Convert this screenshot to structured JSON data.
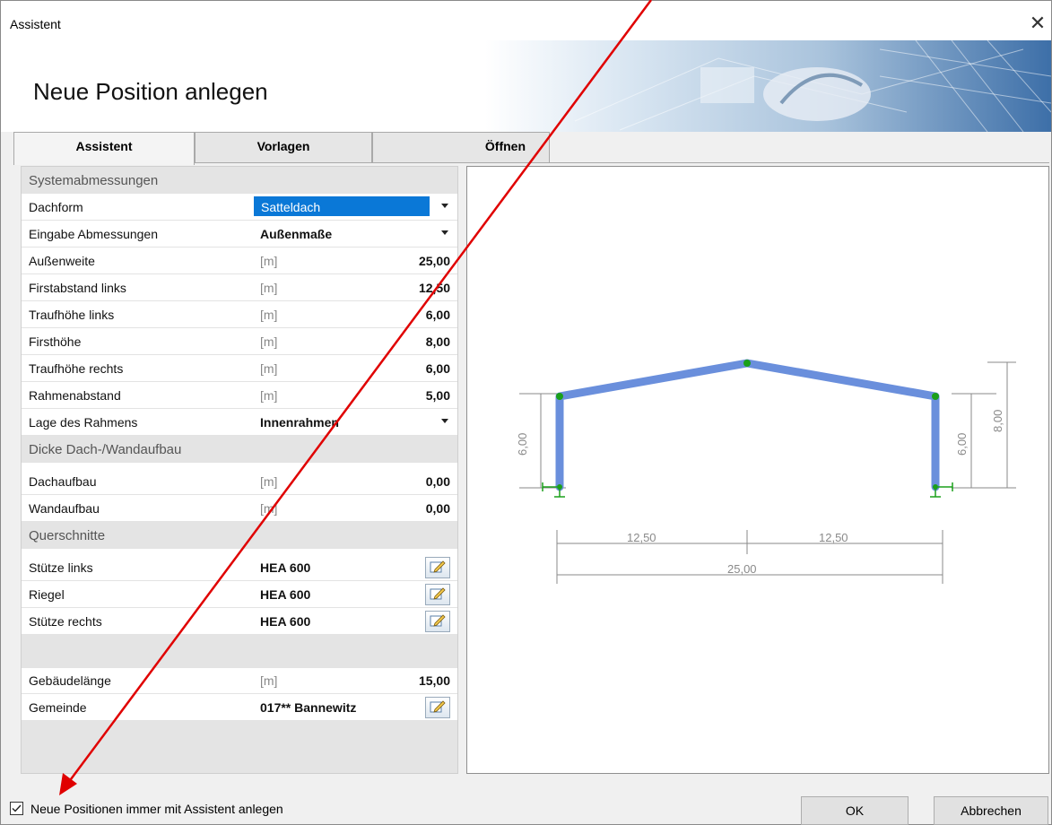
{
  "window": {
    "title": "Assistent",
    "close_icon": "close-icon"
  },
  "banner": {
    "heading": "Neue Position anlegen"
  },
  "tabs": [
    {
      "label": "Assistent",
      "active": true
    },
    {
      "label": "Vorlagen",
      "active": false
    },
    {
      "label": "Öffnen",
      "active": false
    }
  ],
  "grid": {
    "sections": {
      "system": "Systemabmessungen",
      "thickness": "Dicke Dach-/Wandaufbau",
      "cross": "Querschnitte"
    },
    "rows": {
      "dachform": {
        "label": "Dachform",
        "value": "Satteldach"
      },
      "eingabe": {
        "label": "Eingabe Abmessungen",
        "value": "Außenmaße"
      },
      "aussenweite": {
        "label": "Außenweite",
        "unit": "[m]",
        "value": "25,00"
      },
      "firstabstand": {
        "label": "Firstabstand links",
        "unit": "[m]",
        "value": "12,50"
      },
      "traufhoehe_l": {
        "label": "Traufhöhe links",
        "unit": "[m]",
        "value": "6,00"
      },
      "firsthoehe": {
        "label": "Firsthöhe",
        "unit": "[m]",
        "value": "8,00"
      },
      "traufhoehe_r": {
        "label": "Traufhöhe rechts",
        "unit": "[m]",
        "value": "6,00"
      },
      "rahmenabstand": {
        "label": "Rahmenabstand",
        "unit": "[m]",
        "value": "5,00"
      },
      "lage": {
        "label": "Lage des Rahmens",
        "value": "Innenrahmen"
      },
      "dachaufbau": {
        "label": "Dachaufbau",
        "unit": "[m]",
        "value": "0,00"
      },
      "wandaufbau": {
        "label": "Wandaufbau",
        "unit": "[m]",
        "value": "0,00"
      },
      "stuetze_l": {
        "label": "Stütze links",
        "value": "HEA 600"
      },
      "riegel": {
        "label": "Riegel",
        "value": "HEA 600"
      },
      "stuetze_r": {
        "label": "Stütze rechts",
        "value": "HEA 600"
      },
      "gebaeudelaenge": {
        "label": "Gebäudelänge",
        "unit": "[m]",
        "value": "15,00"
      },
      "gemeinde": {
        "label": "Gemeinde",
        "value": "017** Bannewitz"
      }
    }
  },
  "preview": {
    "dims": {
      "left_height": "6,00",
      "right_height": "6,00",
      "ridge_height": "8,00",
      "half_left": "12,50",
      "half_right": "12,50",
      "total": "25,00"
    },
    "colors": {
      "frame": "#6a8fdc",
      "node": "#1aa01a",
      "dim": "#8a8a8a"
    }
  },
  "footer": {
    "checkbox_label": "Neue Positionen immer mit Assistent anlegen",
    "checkbox_checked": true,
    "ok_label": "OK",
    "cancel_label": "Abbrechen"
  },
  "annotation": {
    "color": "#e00000"
  }
}
